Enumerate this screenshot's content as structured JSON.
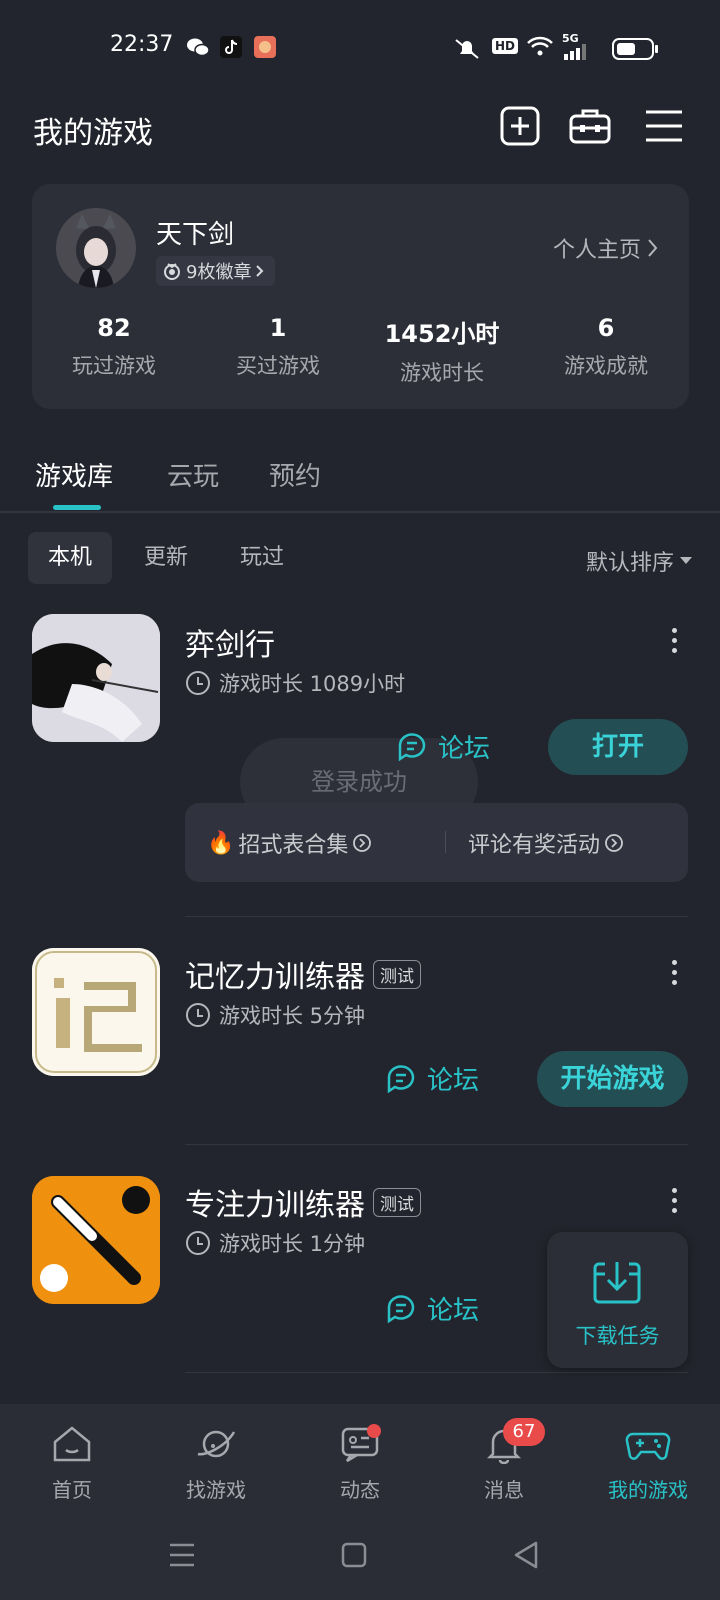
{
  "status_bar": {
    "time": "22:37",
    "network": "5G",
    "hd": "HD"
  },
  "header": {
    "title": "我的游戏"
  },
  "profile": {
    "username": "天下剑",
    "badges": "9枚徽章",
    "homepage_link": "个人主页",
    "stats": [
      {
        "value": "82",
        "label": "玩过游戏"
      },
      {
        "value": "1",
        "label": "买过游戏"
      },
      {
        "value": "1452小时",
        "label": "游戏时长"
      },
      {
        "value": "6",
        "label": "游戏成就"
      }
    ]
  },
  "tabs": [
    {
      "label": "游戏库",
      "active": true
    },
    {
      "label": "云玩",
      "active": false
    },
    {
      "label": "预约",
      "active": false
    }
  ],
  "filters": [
    {
      "label": "本机",
      "active": true
    },
    {
      "label": "更新",
      "active": false
    },
    {
      "label": "玩过",
      "active": false
    }
  ],
  "sort": {
    "label": "默认排序"
  },
  "games": [
    {
      "name": "弈剑行",
      "tag": "",
      "playtime": "游戏时长 1089小时",
      "forum": "论坛",
      "action": "打开",
      "activities": [
        "招式表合集",
        "评论有奖活动"
      ]
    },
    {
      "name": "记忆力训练器",
      "tag": "测试",
      "playtime": "游戏时长 5分钟",
      "forum": "论坛",
      "action": "开始游戏"
    },
    {
      "name": "专注力训练器",
      "tag": "测试",
      "playtime": "游戏时长 1分钟",
      "forum": "论坛",
      "action": ""
    }
  ],
  "toast": {
    "text": "登录成功"
  },
  "download_task": {
    "label": "下载任务"
  },
  "bottom_nav": [
    {
      "label": "首页",
      "icon": "home-icon",
      "active": false
    },
    {
      "label": "找游戏",
      "icon": "planet-icon",
      "active": false
    },
    {
      "label": "动态",
      "icon": "chat-icon",
      "active": false
    },
    {
      "label": "消息",
      "icon": "bell-icon",
      "active": false,
      "badge": "67"
    },
    {
      "label": "我的游戏",
      "icon": "gamepad-icon",
      "active": true
    }
  ],
  "colors": {
    "accent": "#29c2c7",
    "background": "#22252d",
    "card": "#2c2f38",
    "badge_red": "#e94a4a"
  }
}
